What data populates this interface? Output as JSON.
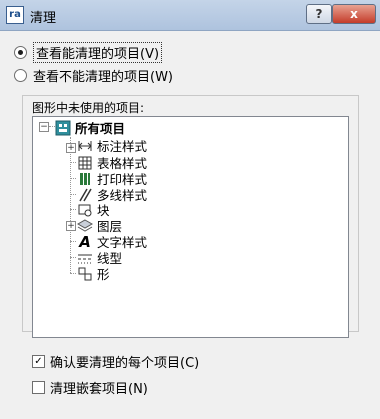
{
  "window": {
    "title": "清理",
    "help_label": "?",
    "close_label": "x"
  },
  "view_options": [
    {
      "label": "查看能清理的项目(V)",
      "selected": true
    },
    {
      "label": "查看不能清理的项目(W)",
      "selected": false
    }
  ],
  "tree": {
    "group_label": "图形中未使用的项目:",
    "root_label": "所有项目",
    "items": [
      {
        "label": "标注样式",
        "icon": "dimension-style-icon",
        "expandable": true
      },
      {
        "label": "表格样式",
        "icon": "table-style-icon",
        "expandable": false
      },
      {
        "label": "打印样式",
        "icon": "plot-style-icon",
        "expandable": false
      },
      {
        "label": "多线样式",
        "icon": "multiline-style-icon",
        "expandable": false
      },
      {
        "label": "块",
        "icon": "block-icon",
        "expandable": false
      },
      {
        "label": "图层",
        "icon": "layer-icon",
        "expandable": true
      },
      {
        "label": "文字样式",
        "icon": "text-style-icon",
        "expandable": false
      },
      {
        "label": "线型",
        "icon": "linetype-icon",
        "expandable": false
      },
      {
        "label": "形",
        "icon": "shape-icon",
        "expandable": false
      }
    ]
  },
  "options": {
    "confirm_label": "确认要清理的每个项目(C)",
    "confirm_checked": true,
    "nested_label": "清理嵌套项目(N)",
    "nested_checked": false
  }
}
